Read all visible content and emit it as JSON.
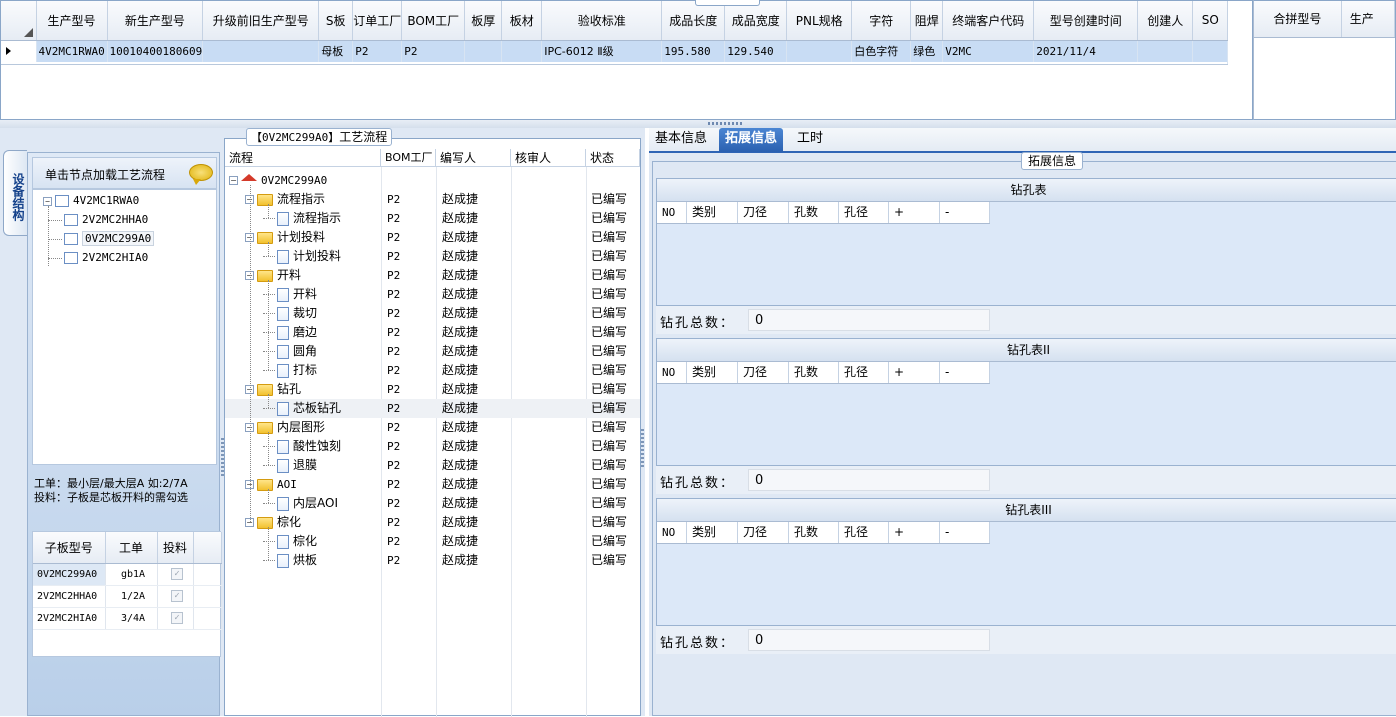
{
  "top_grid": {
    "columns": [
      "生产型号",
      "新生产型号",
      "升级前旧生产型号",
      "S板",
      "订单工厂",
      "BOM工厂",
      "板厚",
      "板材",
      "验收标准",
      "成品长度",
      "成品宽度",
      "PNL规格",
      "字符",
      "阻焊",
      "终端客户代码",
      "型号创建时间",
      "创建人",
      "SO"
    ],
    "rows": [
      [
        "4V2MC1RWA0",
        "10010400180609",
        "",
        "母板",
        "P2",
        "P2",
        "",
        "",
        "IPC-6012 Ⅱ级",
        "195.580",
        "129.540",
        "",
        "白色字符",
        "绿色",
        "V2MC",
        "2021/11/4",
        "",
        ""
      ]
    ]
  },
  "merge_grid": {
    "columns": [
      "合拼型号",
      "生产"
    ]
  },
  "left_panel": {
    "vertical_tab": "设备结构",
    "nav_header": "单击节点加载工艺流程",
    "tree": {
      "root": "4V2MC1RWA0",
      "children": [
        "2V2MC2HHA0",
        "0V2MC299A0",
        "2V2MC2HIA0"
      ],
      "selected": "0V2MC299A0"
    },
    "note_line1": "工单：最小层/最大层A 如:2/7A",
    "note_line2": "投料：子板是芯板开料的需勾选",
    "sub_grid": {
      "columns": [
        "子板型号",
        "工单",
        "投料"
      ],
      "rows": [
        {
          "model": "0V2MC299A0",
          "order": "gb1A",
          "checked": true
        },
        {
          "model": "2V2MC2HHA0",
          "order": "1/2A",
          "checked": true
        },
        {
          "model": "2V2MC2HIA0",
          "order": "3/4A",
          "checked": true
        }
      ]
    }
  },
  "process": {
    "legend_code": "【0V2MC299A0】",
    "legend_text": "工艺流程",
    "columns": [
      "流程",
      "BOM工厂",
      "编写人",
      "核审人",
      "状态"
    ],
    "root": "0V2MC299A0",
    "rows": [
      {
        "label": "流程指示",
        "level": 1,
        "folder": true,
        "bom": "P2",
        "writer": "赵成捷",
        "reviewer": "",
        "status": "已编写"
      },
      {
        "label": "流程指示",
        "level": 2,
        "folder": false,
        "bom": "P2",
        "writer": "赵成捷",
        "reviewer": "",
        "status": "已编写"
      },
      {
        "label": "计划投料",
        "level": 1,
        "folder": true,
        "bom": "P2",
        "writer": "赵成捷",
        "reviewer": "",
        "status": "已编写"
      },
      {
        "label": "计划投料",
        "level": 2,
        "folder": false,
        "bom": "P2",
        "writer": "赵成捷",
        "reviewer": "",
        "status": "已编写"
      },
      {
        "label": "开料",
        "level": 1,
        "folder": true,
        "bom": "P2",
        "writer": "赵成捷",
        "reviewer": "",
        "status": "已编写"
      },
      {
        "label": "开料",
        "level": 2,
        "folder": false,
        "bom": "P2",
        "writer": "赵成捷",
        "reviewer": "",
        "status": "已编写"
      },
      {
        "label": "裁切",
        "level": 2,
        "folder": false,
        "bom": "P2",
        "writer": "赵成捷",
        "reviewer": "",
        "status": "已编写"
      },
      {
        "label": "磨边",
        "level": 2,
        "folder": false,
        "bom": "P2",
        "writer": "赵成捷",
        "reviewer": "",
        "status": "已编写"
      },
      {
        "label": "圆角",
        "level": 2,
        "folder": false,
        "bom": "P2",
        "writer": "赵成捷",
        "reviewer": "",
        "status": "已编写"
      },
      {
        "label": "打标",
        "level": 2,
        "folder": false,
        "bom": "P2",
        "writer": "赵成捷",
        "reviewer": "",
        "status": "已编写"
      },
      {
        "label": "钻孔",
        "level": 1,
        "folder": true,
        "bom": "P2",
        "writer": "赵成捷",
        "reviewer": "",
        "status": "已编写"
      },
      {
        "label": "芯板钻孔",
        "level": 2,
        "folder": false,
        "bom": "P2",
        "writer": "赵成捷",
        "reviewer": "",
        "status": "已编写"
      },
      {
        "label": "内层图形",
        "level": 1,
        "folder": true,
        "bom": "P2",
        "writer": "赵成捷",
        "reviewer": "",
        "status": "已编写"
      },
      {
        "label": "酸性蚀刻",
        "level": 2,
        "folder": false,
        "bom": "P2",
        "writer": "赵成捷",
        "reviewer": "",
        "status": "已编写"
      },
      {
        "label": "退膜",
        "level": 2,
        "folder": false,
        "bom": "P2",
        "writer": "赵成捷",
        "reviewer": "",
        "status": "已编写"
      },
      {
        "label": "AOI",
        "level": 1,
        "folder": true,
        "bom": "P2",
        "writer": "赵成捷",
        "reviewer": "",
        "status": "已编写"
      },
      {
        "label": "内层AOI",
        "level": 2,
        "folder": false,
        "bom": "P2",
        "writer": "赵成捷",
        "reviewer": "",
        "status": "已编写"
      },
      {
        "label": "棕化",
        "level": 1,
        "folder": true,
        "bom": "P2",
        "writer": "赵成捷",
        "reviewer": "",
        "status": "已编写"
      },
      {
        "label": "棕化",
        "level": 2,
        "folder": false,
        "bom": "P2",
        "writer": "赵成捷",
        "reviewer": "",
        "status": "已编写"
      },
      {
        "label": "烘板",
        "level": 2,
        "folder": false,
        "bom": "P2",
        "writer": "赵成捷",
        "reviewer": "",
        "status": "已编写"
      }
    ],
    "selected_row": "芯板钻孔"
  },
  "right_panel": {
    "tabs": [
      "基本信息",
      "拓展信息",
      "工时"
    ],
    "active_tab": "拓展信息",
    "section_legend": "拓展信息",
    "drill_columns": [
      "NO",
      "类别",
      "刀径",
      "孔数",
      "孔径",
      "+",
      "-"
    ],
    "drill_tables": [
      {
        "title": "钻孔表",
        "total_label": "钻孔总数：",
        "total": "0"
      },
      {
        "title": "钻孔表II",
        "total_label": "钻孔总数：",
        "total": "0"
      },
      {
        "title": "钻孔表III",
        "total_label": "钻孔总数：",
        "total": "0"
      }
    ]
  },
  "colors": {
    "accent": "#2a60b0",
    "row_selected": "#c8dcf4",
    "panel_bg": "#dfe8f4"
  }
}
